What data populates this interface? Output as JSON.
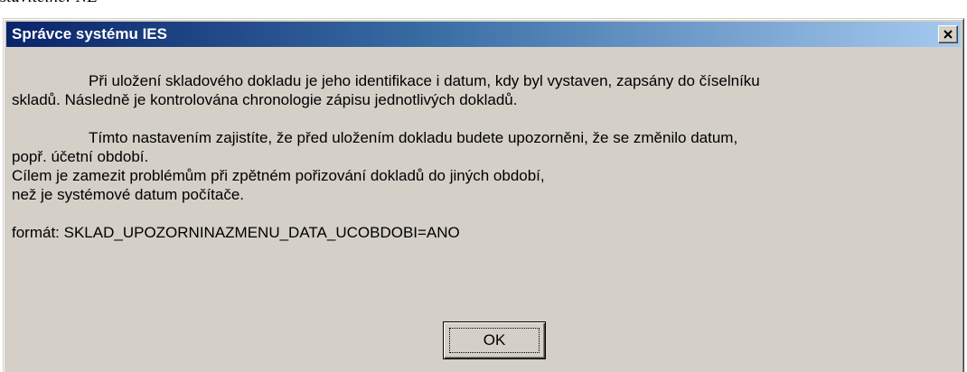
{
  "background": {
    "partial_text": "stavitelné: NE"
  },
  "dialog": {
    "title": "Správce systému IES",
    "close_icon": "close-x-icon",
    "titlebar_color_start": "#0a246a",
    "titlebar_color_end": "#a6caf0",
    "message": {
      "para1_line1": "Při uložení skladového dokladu je jeho identifikace i datum, kdy byl vystaven, zapsány do číselníku",
      "para1_line2": "skladů. Následně je kontrolována chronologie zápisu jednotlivých dokladů.",
      "para2_line1": "Tímto nastavením zajistíte, že před uložením dokladu budete upozorněni, že se změnilo datum,",
      "para2_line2": "popř. účetní období.",
      "para2_line3": "Cílem je zamezit problémům při zpětném pořizování dokladů do jiných období,",
      "para2_line4": "než je systémové datum počítače.",
      "format_line": "formát: SKLAD_UPOZORNINAZMENU_DATA_UCOBDOBI=ANO"
    },
    "ok_label": "OK"
  }
}
